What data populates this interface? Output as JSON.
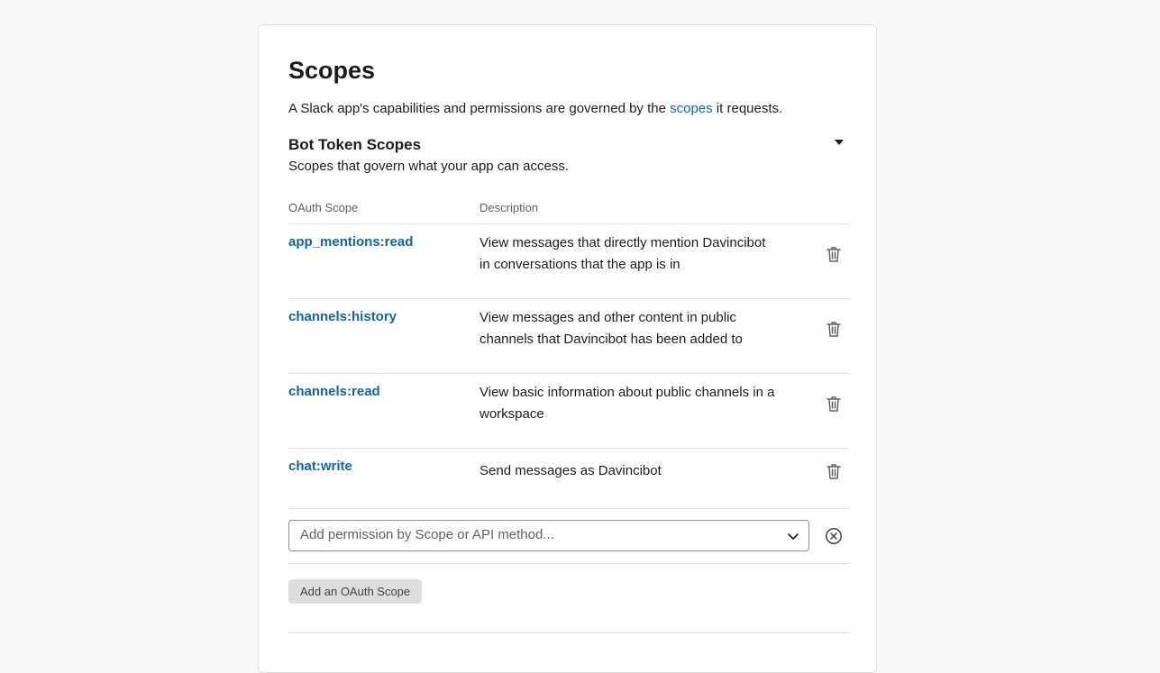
{
  "page": {
    "title": "Scopes",
    "intro_before": "A Slack app's capabilities and permissions are governed by the ",
    "intro_link": "scopes",
    "intro_after": " it requests."
  },
  "bot_scopes": {
    "title": "Bot Token Scopes",
    "subtitle": "Scopes that govern what your app can access.",
    "columns": {
      "scope": "OAuth Scope",
      "description": "Description"
    },
    "rows": [
      {
        "scope": "app_mentions:read",
        "description": "View messages that directly mention Davincibot in conversations that the app is in"
      },
      {
        "scope": "channels:history",
        "description": "View messages and other content in public channels that Davincibot has been added to"
      },
      {
        "scope": "channels:read",
        "description": "View basic information about public channels in a workspace"
      },
      {
        "scope": "chat:write",
        "description": "Send messages as Davincibot"
      }
    ],
    "add_select_placeholder": "Add permission by Scope or API method...",
    "add_button_label": "Add an OAuth Scope"
  },
  "icons": {
    "collapse": "caret-down-icon",
    "remove": "trash-icon",
    "dropdown": "chevron-down-icon",
    "clear": "circle-x-icon"
  },
  "colors": {
    "link": "#1264a3",
    "text": "#1d1c1d",
    "muted": "#616061",
    "button_bg": "#dddddd"
  }
}
